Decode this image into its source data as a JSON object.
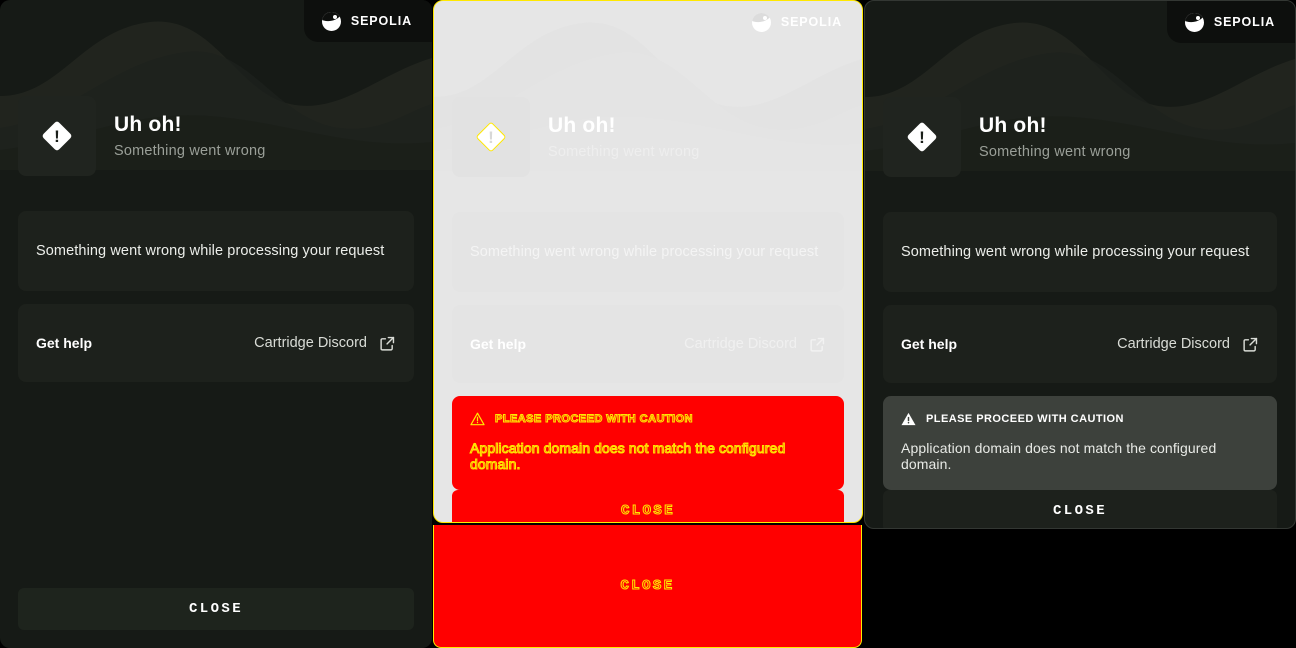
{
  "network": {
    "label": "SEPOLIA",
    "logo_icon": "cartridge-logo-icon"
  },
  "header": {
    "title": "Uh oh!",
    "subtitle": "Something went wrong",
    "icon": "error-diamond-icon",
    "bang": "!"
  },
  "message_card": {
    "text": "Something went wrong while processing your request"
  },
  "help_card": {
    "label": "Get help",
    "link_text": "Cartridge Discord",
    "link_icon": "external-link-icon"
  },
  "caution": {
    "title": "PLEASE PROCEED WITH CAUTION",
    "text": "Application domain does not match the configured domain.",
    "icon": "warning-triangle-icon"
  },
  "actions": {
    "close_label": "CLOSE"
  },
  "colors": {
    "panel_dark_bg": "#161a16",
    "card_dark_bg": "#1d211c",
    "caution_dark_bg": "#3d413c",
    "panel_light_bg": "#e6e6e6",
    "forced_red": "#ff0000",
    "forced_yellow": "#ffe800",
    "text_primary": "#ffffff",
    "text_muted": "#9a9f98"
  },
  "panels": [
    {
      "variant": "dark-full"
    },
    {
      "variant": "forced-colors-light"
    },
    {
      "variant": "dark-with-caution"
    }
  ]
}
